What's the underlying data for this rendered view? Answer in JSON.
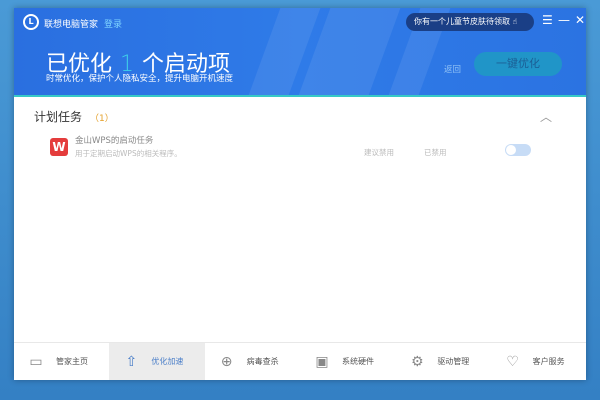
{
  "header": {
    "app_name": "联想电脑管家",
    "login": "登录",
    "promo": "你有一个儿童节皮肤待领取",
    "title_prefix": "已优化",
    "count": "1",
    "title_suffix": "个启动项",
    "subtitle": "时常优化，保护个人隐私安全，提升电脑开机速度",
    "back": "返回",
    "optimize_button": "一键优化"
  },
  "section": {
    "title": "计划任务",
    "count": "（1）"
  },
  "items": [
    {
      "name": "金山WPS的启动任务",
      "desc": "用于定期启动WPS的相关程序。",
      "suggestion": "建议禁用",
      "status": "已禁用",
      "enabled": false
    }
  ],
  "nav": [
    {
      "label": "管家主页",
      "icon": "monitor-icon"
    },
    {
      "label": "优化加速",
      "icon": "rocket-icon"
    },
    {
      "label": "病毒查杀",
      "icon": "shield-icon"
    },
    {
      "label": "系统硬件",
      "icon": "chip-icon"
    },
    {
      "label": "驱动管理",
      "icon": "gear-icon"
    },
    {
      "label": "客户服务",
      "icon": "heart-icon"
    }
  ]
}
